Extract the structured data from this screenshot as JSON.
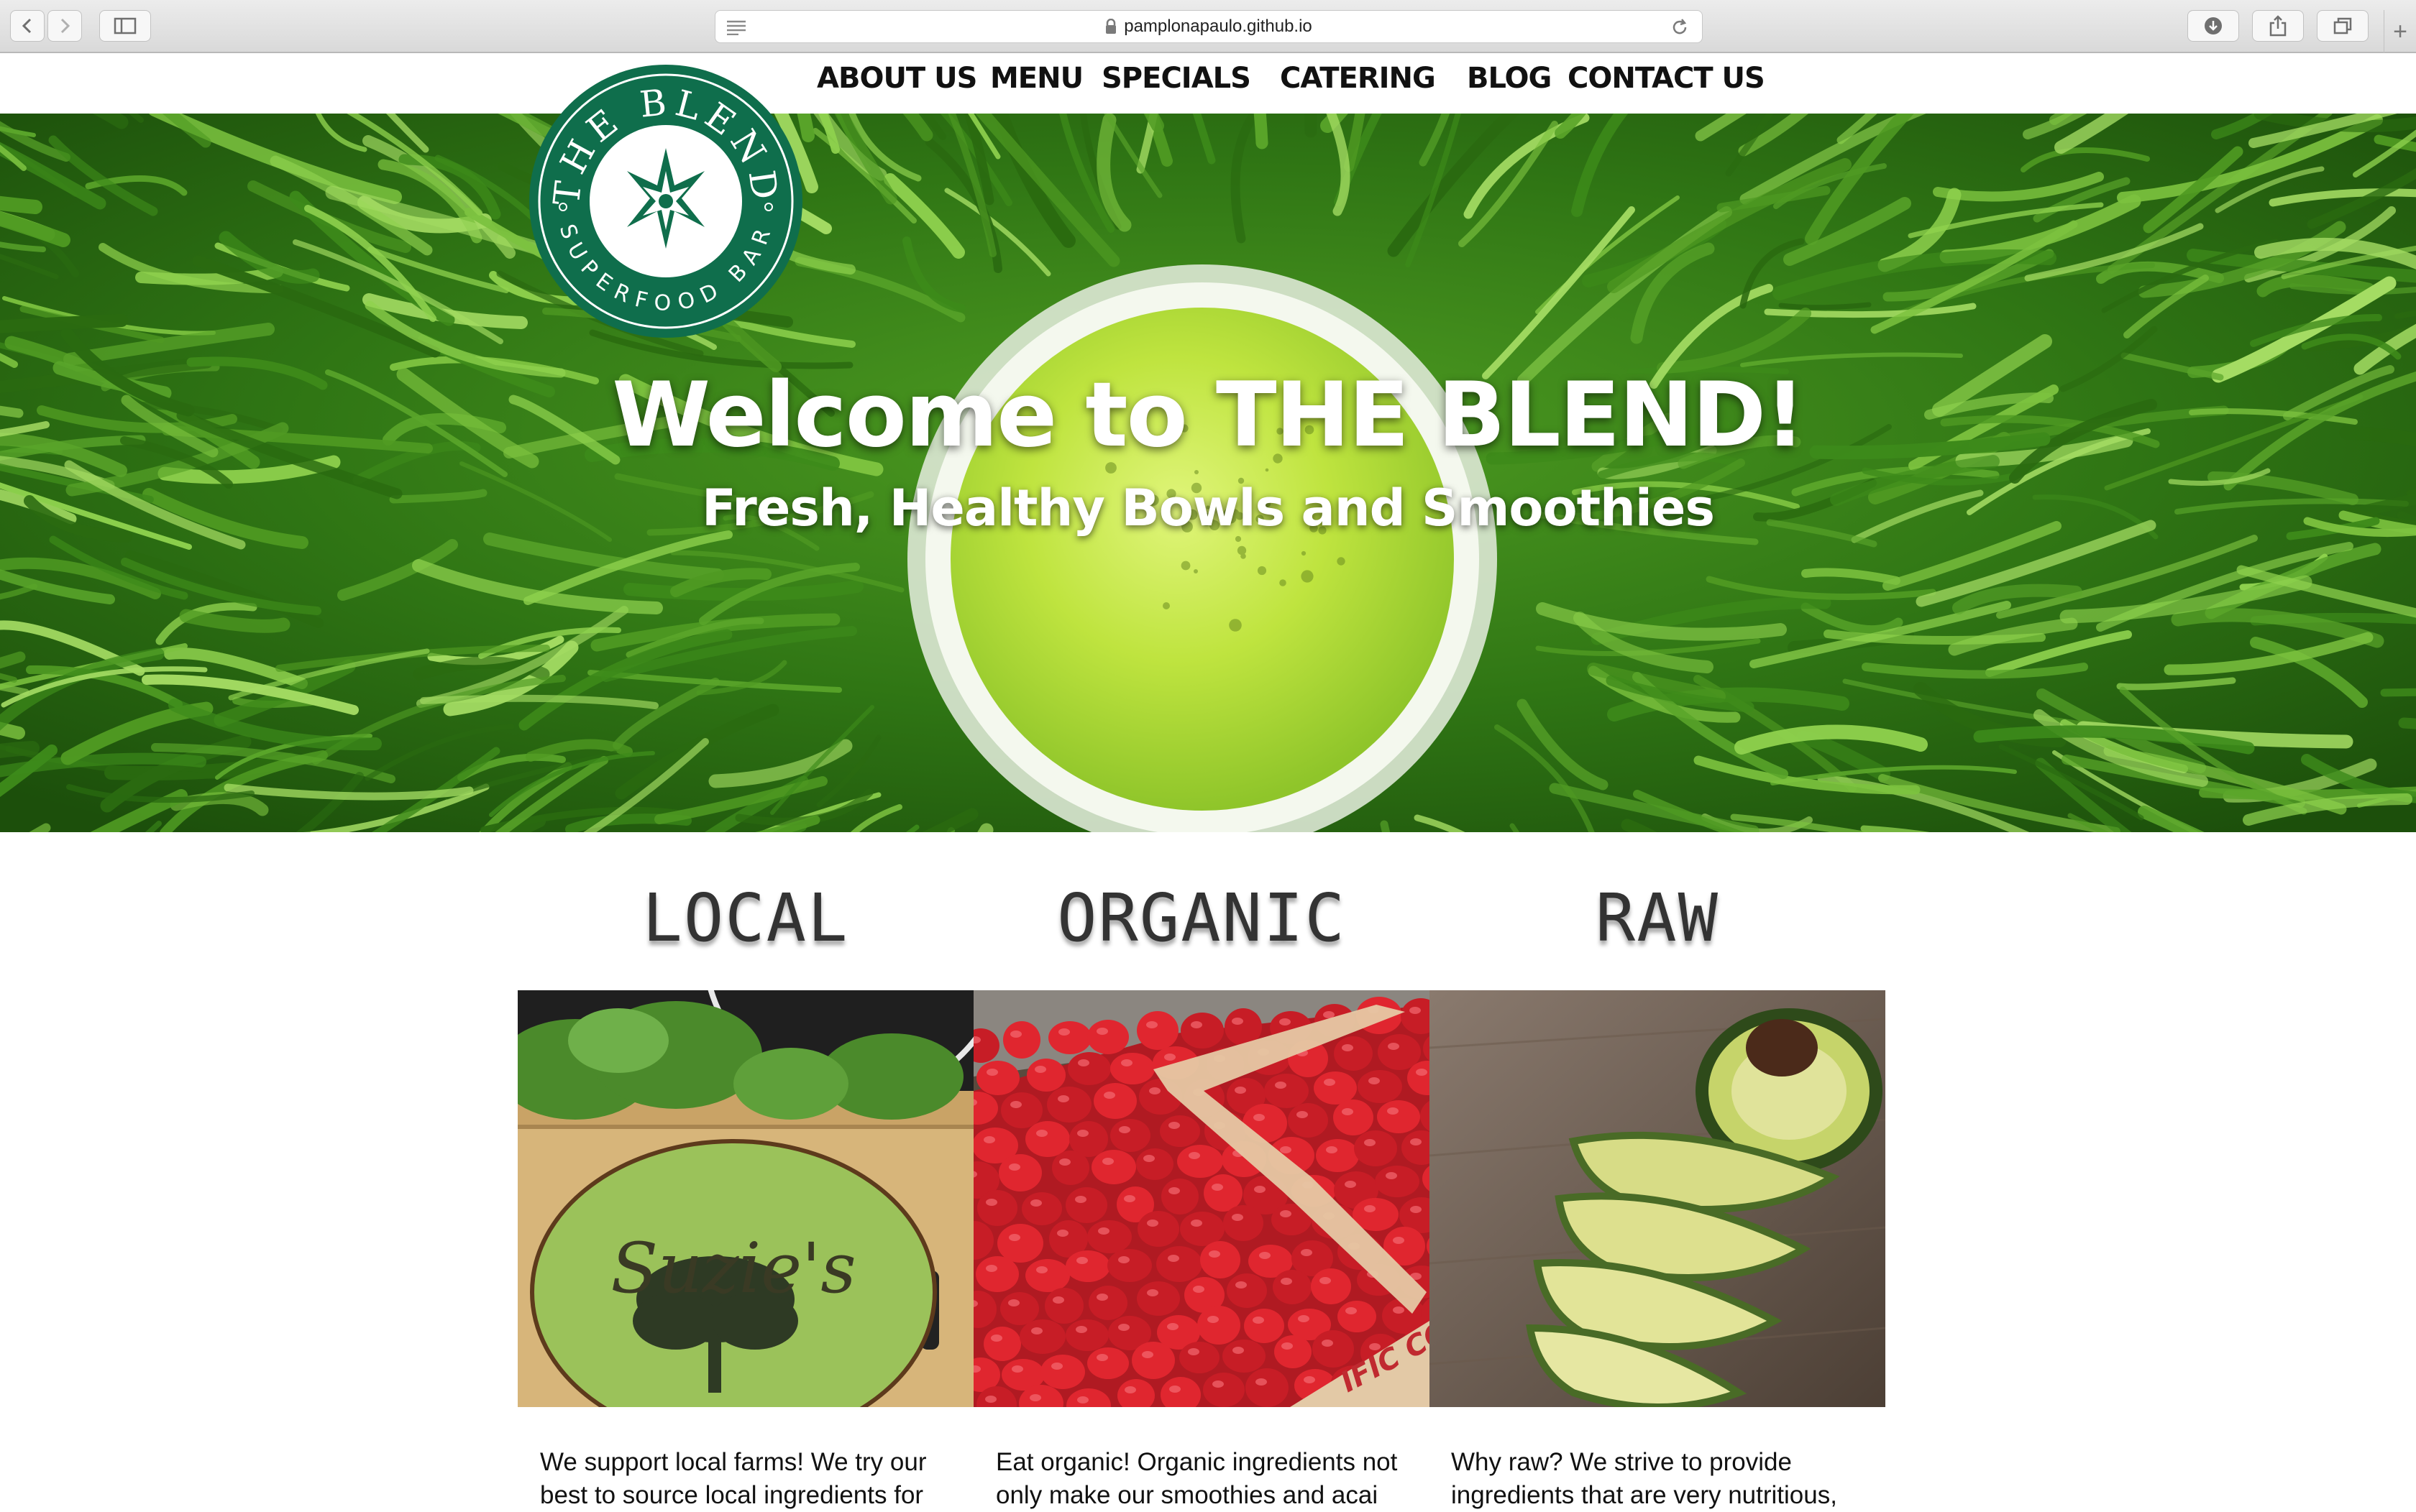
{
  "browser": {
    "url": "pamplonapaulo.github.io"
  },
  "nav": {
    "items": [
      "ABOUT US",
      "MENU",
      "SPECIALS",
      "CATERING",
      "BLOG",
      "CONTACT US"
    ]
  },
  "logo": {
    "top_text": "THE BLEND",
    "bottom_text": "SUPERFOOD BAR",
    "color": "#0f6e4c"
  },
  "hero": {
    "title": "Welcome to THE BLEND!",
    "subtitle": "Fresh, Healthy Bowls and Smoothies"
  },
  "features": [
    {
      "title": "LOCAL",
      "image_label": "Suzie's",
      "text": "We support local farms! We try our best to source local ingredients for"
    },
    {
      "title": "ORGANIC",
      "image_label": "IFIC COAS",
      "text": "Eat organic! Organic ingredients not only make our smoothies and acai"
    },
    {
      "title": "RAW",
      "text": "Why raw? We strive to provide ingredients that are very nutritious,"
    }
  ],
  "colors": {
    "brand_green": "#0f6e4c",
    "grass_green": "#3f8f1e",
    "juice_green": "#b7e03b"
  }
}
